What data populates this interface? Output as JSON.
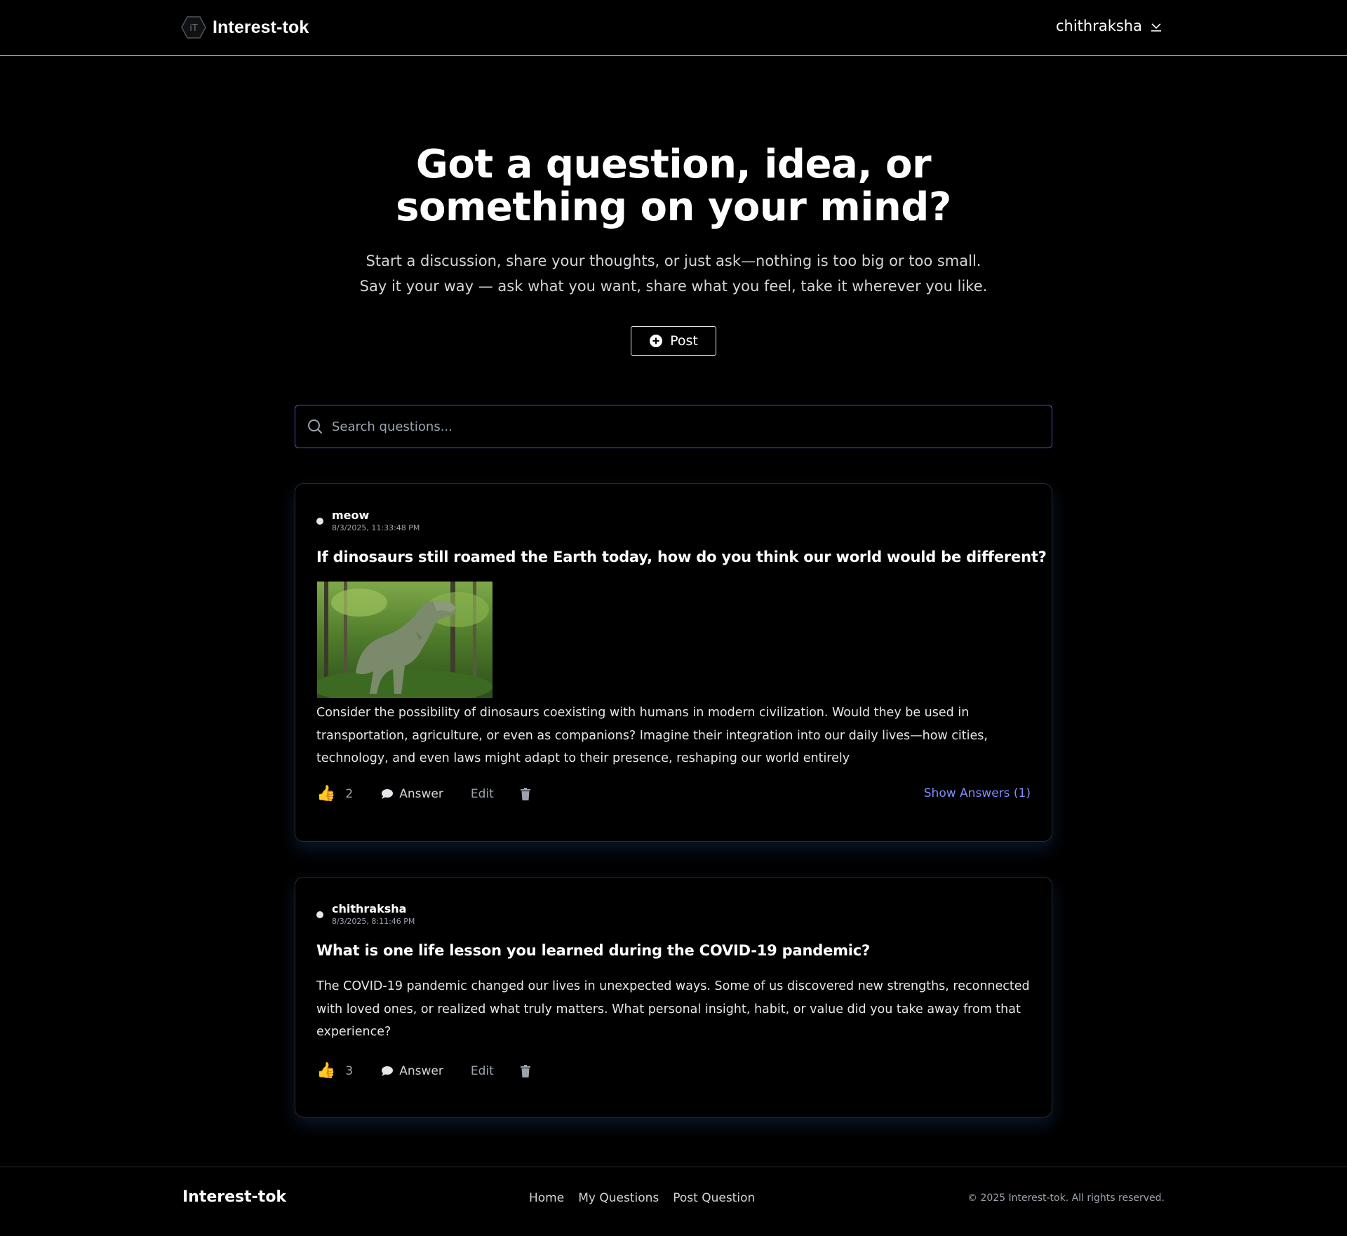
{
  "header": {
    "brand_logo_text": "iT",
    "brand_name": "Interest-tok",
    "user_name": "chithraksha"
  },
  "hero": {
    "title_line1": "Got a question, idea, or",
    "title_line2": "something on your mind?",
    "subtitle_line1": "Start a discussion, share your thoughts, or just ask—nothing is too big or too small.",
    "subtitle_line2": "Say it your way — ask what you want, share what you feel, take it wherever you like.",
    "post_label": "Post"
  },
  "search": {
    "placeholder": "Search questions..."
  },
  "questions": [
    {
      "author": "meow",
      "timestamp": "8/3/2025, 11:33:48 PM",
      "title": "If dinosaurs still roamed the Earth today, how do you think our world would be different?",
      "body": "Consider the possibility of dinosaurs coexisting with humans in modern civilization. Would they be used in transportation, agriculture, or even as companions? Imagine their integration into our daily lives—how cities, technology, and even laws might adapt to their presence, reshaping our world entirely",
      "likes": "2",
      "answer_label": "Answer",
      "edit_label": "Edit",
      "show_answers_label": "Show Answers (1)"
    },
    {
      "author": "chithraksha",
      "timestamp": "8/3/2025, 8:11:46 PM",
      "title": "What is one life lesson you learned during the COVID-19 pandemic?",
      "body": "The COVID-19 pandemic changed our lives in unexpected ways. Some of us discovered new strengths, reconnected with loved ones, or realized what truly matters. What personal insight, habit, or value did you take away from that experience?",
      "likes": "3",
      "answer_label": "Answer",
      "edit_label": "Edit"
    }
  ],
  "footer": {
    "brand_name": "Interest-tok",
    "nav": [
      "Home",
      "My Questions",
      "Post Question"
    ],
    "copyright": "© 2025 Interest-tok. All rights reserved."
  },
  "colors": {
    "background": "#000000",
    "accent": "#818cf8",
    "search_border": "#5b4bd6",
    "like_icon": "#f5b82e"
  },
  "icons": {
    "logo": "hexagon-logo-icon",
    "user_menu": "chevron-down-icon",
    "post": "plus-circle-icon",
    "search": "search-icon",
    "like": "thumbs-up-icon",
    "answer": "speech-bubble-icon",
    "delete": "trash-icon"
  }
}
